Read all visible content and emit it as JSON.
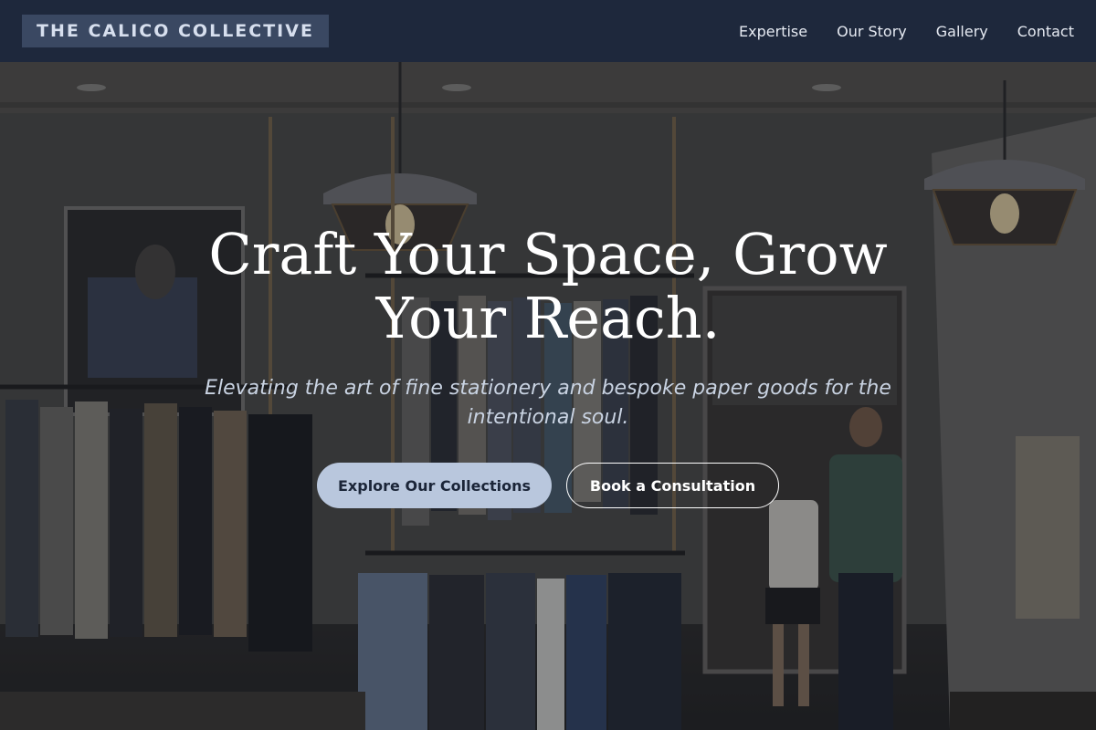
{
  "brand": {
    "name": "THE CALICO COLLECTIVE"
  },
  "nav": {
    "items": [
      {
        "label": "Expertise"
      },
      {
        "label": "Our Story"
      },
      {
        "label": "Gallery"
      },
      {
        "label": "Contact"
      }
    ]
  },
  "hero": {
    "title": "Craft Your Space, Grow Your Reach.",
    "subtitle": "Elevating the art of fine stationery and bespoke paper goods for the intentional soul.",
    "primary_button": "Explore Our Collections",
    "secondary_button": "Book a Consultation"
  },
  "colors": {
    "nav_bg": "#1e283c",
    "brand_bg": "#3a4862",
    "primary_button_bg": "#b9c7dd",
    "primary_button_text": "#1b2538"
  }
}
